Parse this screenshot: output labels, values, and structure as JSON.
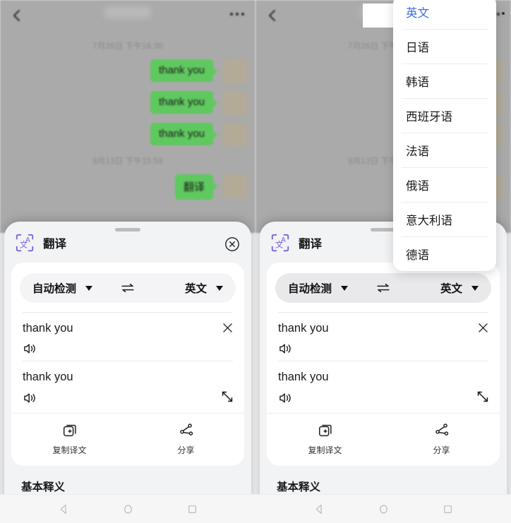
{
  "chat": {
    "back_icon": "chevron-left-icon",
    "more_icon": "more-options-icon",
    "title_redacted": "",
    "date_1": "7月26日 下午16:30",
    "date_2": "9月13日 下午15:58",
    "messages": [
      "thank you",
      "thank you",
      "thank you"
    ],
    "pending_message": "翻译",
    "bubble_color": "#5fc85f"
  },
  "sheet": {
    "title": "翻译",
    "app_icon": "translate-icon",
    "close_icon": "close-circle-icon",
    "drag_handle": "drag-handle",
    "lang_from": "自动检测",
    "lang_to": "英文",
    "swap_icon": "swap-horizontal-icon",
    "source_text": "thank you",
    "target_text": "thank you",
    "clear_icon": "clear-x-icon",
    "speaker_icon": "speaker-icon",
    "expand_icon": "expand-fullscreen-icon",
    "actions": [
      {
        "label": "复制译文",
        "icon": "copy-icon"
      },
      {
        "label": "分享",
        "icon": "share-icon"
      }
    ],
    "section_title": "基本释义"
  },
  "dropdown": {
    "selected": "英文",
    "selected_color": "#3b6ee0",
    "items": [
      "英文",
      "日语",
      "韩语",
      "西班牙语",
      "法语",
      "俄语",
      "意大利语",
      "德语"
    ]
  },
  "navbar": {
    "back": "nav-back-icon",
    "home": "nav-home-icon",
    "recents": "nav-recents-icon"
  }
}
